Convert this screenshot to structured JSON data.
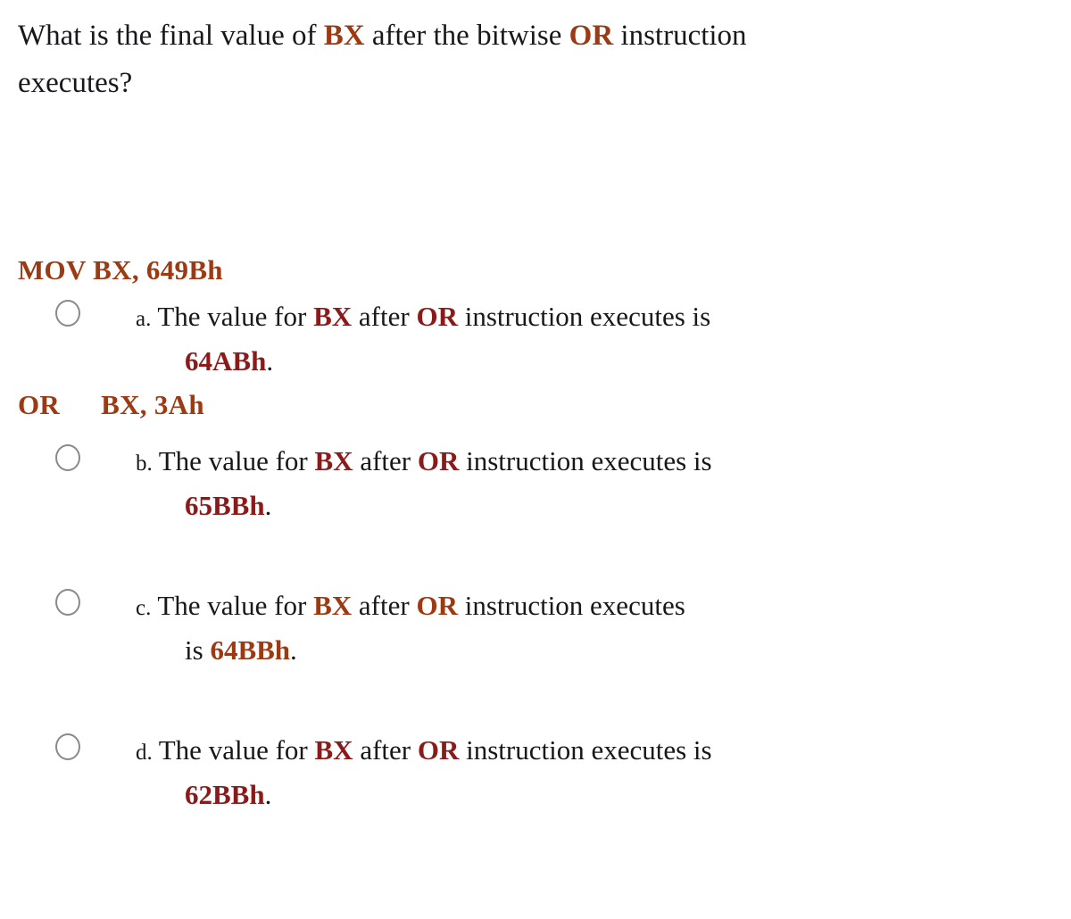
{
  "colors": {
    "text": "#16181c",
    "accent_orange": "#9C3A14",
    "accent_crimson": "#8B1A1A",
    "radio_border": "#8a8a8a",
    "background": "#ffffff"
  },
  "question": {
    "line1_part1": "What is the final value of ",
    "line1_kw1": "BX",
    "line1_part2": " after the bitwise ",
    "line1_kw2": "OR",
    "line1_part3": " instruction",
    "line2": "executes?"
  },
  "code": {
    "line1": "MOV BX, 649Bh",
    "line2_op": "OR",
    "line2_operands": "BX, 3Ah"
  },
  "options": [
    {
      "letter": "a.",
      "radio_name": "radio-option-a",
      "selected": false,
      "l1_t1": "The value for ",
      "l1_kw1": "BX",
      "l1_t2": " after ",
      "l1_kw2": "OR",
      "l1_t3": " instruction executes is",
      "l2_t1": "",
      "l2_value": "64ABh",
      "l2_t2": ".",
      "accent": "#8B1A1A"
    },
    {
      "letter": "b.",
      "radio_name": "radio-option-b",
      "selected": false,
      "l1_t1": "The value for ",
      "l1_kw1": "BX",
      "l1_t2": " after ",
      "l1_kw2": "OR",
      "l1_t3": " instruction executes is",
      "l2_t1": "",
      "l2_value": "65BBh",
      "l2_t2": ".",
      "accent": "#8B1A1A"
    },
    {
      "letter": "c.",
      "radio_name": "radio-option-c",
      "selected": false,
      "l1_t1": "The value for ",
      "l1_kw1": "BX",
      "l1_t2": " after ",
      "l1_kw2": "OR",
      "l1_t3": " instruction executes",
      "l2_t1": "is ",
      "l2_value": "64BBh",
      "l2_t2": ".",
      "accent": "#9C3A14"
    },
    {
      "letter": "d.",
      "radio_name": "radio-option-d",
      "selected": false,
      "l1_t1": "The value for ",
      "l1_kw1": "BX",
      "l1_t2": " after ",
      "l1_kw2": "OR",
      "l1_t3": " instruction executes is",
      "l2_t1": "",
      "l2_value": "62BBh",
      "l2_t2": ".",
      "accent": "#8B1A1A"
    }
  ]
}
